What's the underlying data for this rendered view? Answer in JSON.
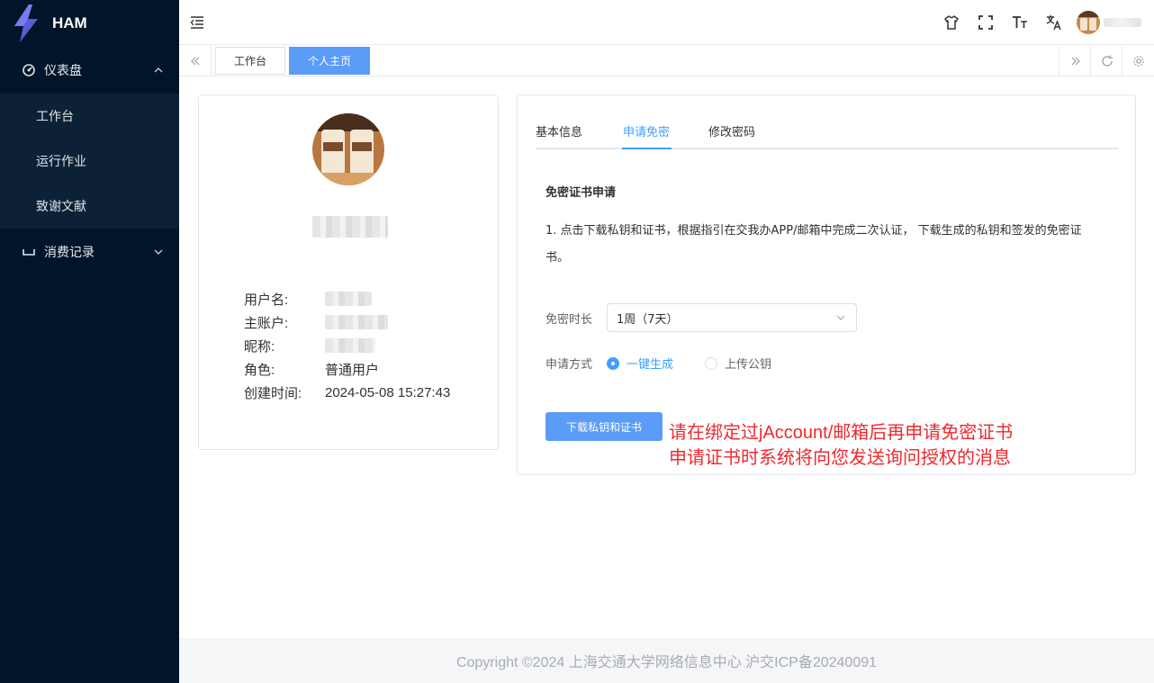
{
  "app": {
    "name": "HAM"
  },
  "sidebar": {
    "groups": [
      {
        "label": "仪表盘",
        "icon": "dashboard-icon",
        "expanded": true,
        "items": [
          {
            "label": "工作台"
          },
          {
            "label": "运行作业"
          },
          {
            "label": "致谢文献"
          }
        ]
      },
      {
        "label": "消费记录",
        "icon": "record-icon",
        "expanded": false
      }
    ]
  },
  "header": {
    "icons": [
      "menu-toggle-icon",
      "theme-icon",
      "fullscreen-icon",
      "font-size-icon",
      "translate-icon"
    ]
  },
  "tabs_bar": {
    "tabs": [
      {
        "label": "工作台",
        "active": false
      },
      {
        "label": "个人主页",
        "active": true
      }
    ]
  },
  "profile": {
    "rows": [
      {
        "key": "用户名:"
      },
      {
        "key": "主账户:"
      },
      {
        "key": "昵称:"
      },
      {
        "key": "角色:",
        "value": "普通用户"
      },
      {
        "key": "创建时间:",
        "value": "2024-05-08 15:27:43"
      }
    ]
  },
  "settings": {
    "tabs": [
      {
        "label": "基本信息"
      },
      {
        "label": "申请免密"
      },
      {
        "label": "修改密码"
      }
    ],
    "active_tab": 1,
    "section_title": "免密证书申请",
    "description": "1. 点击下载私钥和证书，根据指引在交我办APP/邮箱中完成二次认证， 下载生成的私钥和签发的免密证书。",
    "duration_label": "免密时长",
    "duration_value": "1周（7天）",
    "method_label": "申请方式",
    "methods": [
      {
        "label": "一键生成",
        "checked": true
      },
      {
        "label": "上传公钥",
        "checked": false
      }
    ],
    "download_button": "下载私钥和证书",
    "annotation_line1": "请在绑定过jAccount/邮箱后再申请免密证书",
    "annotation_line2": "申请证书时系统将向您发送询问授权的消息"
  },
  "footer": {
    "text": "Copyright ©2024 上海交通大学网络信息中心 沪交ICP备20240091"
  },
  "colors": {
    "sidebar_bg": "#001529",
    "primary": "#409eff",
    "button": "#5b9cf8",
    "annotation": "#f0282d"
  }
}
